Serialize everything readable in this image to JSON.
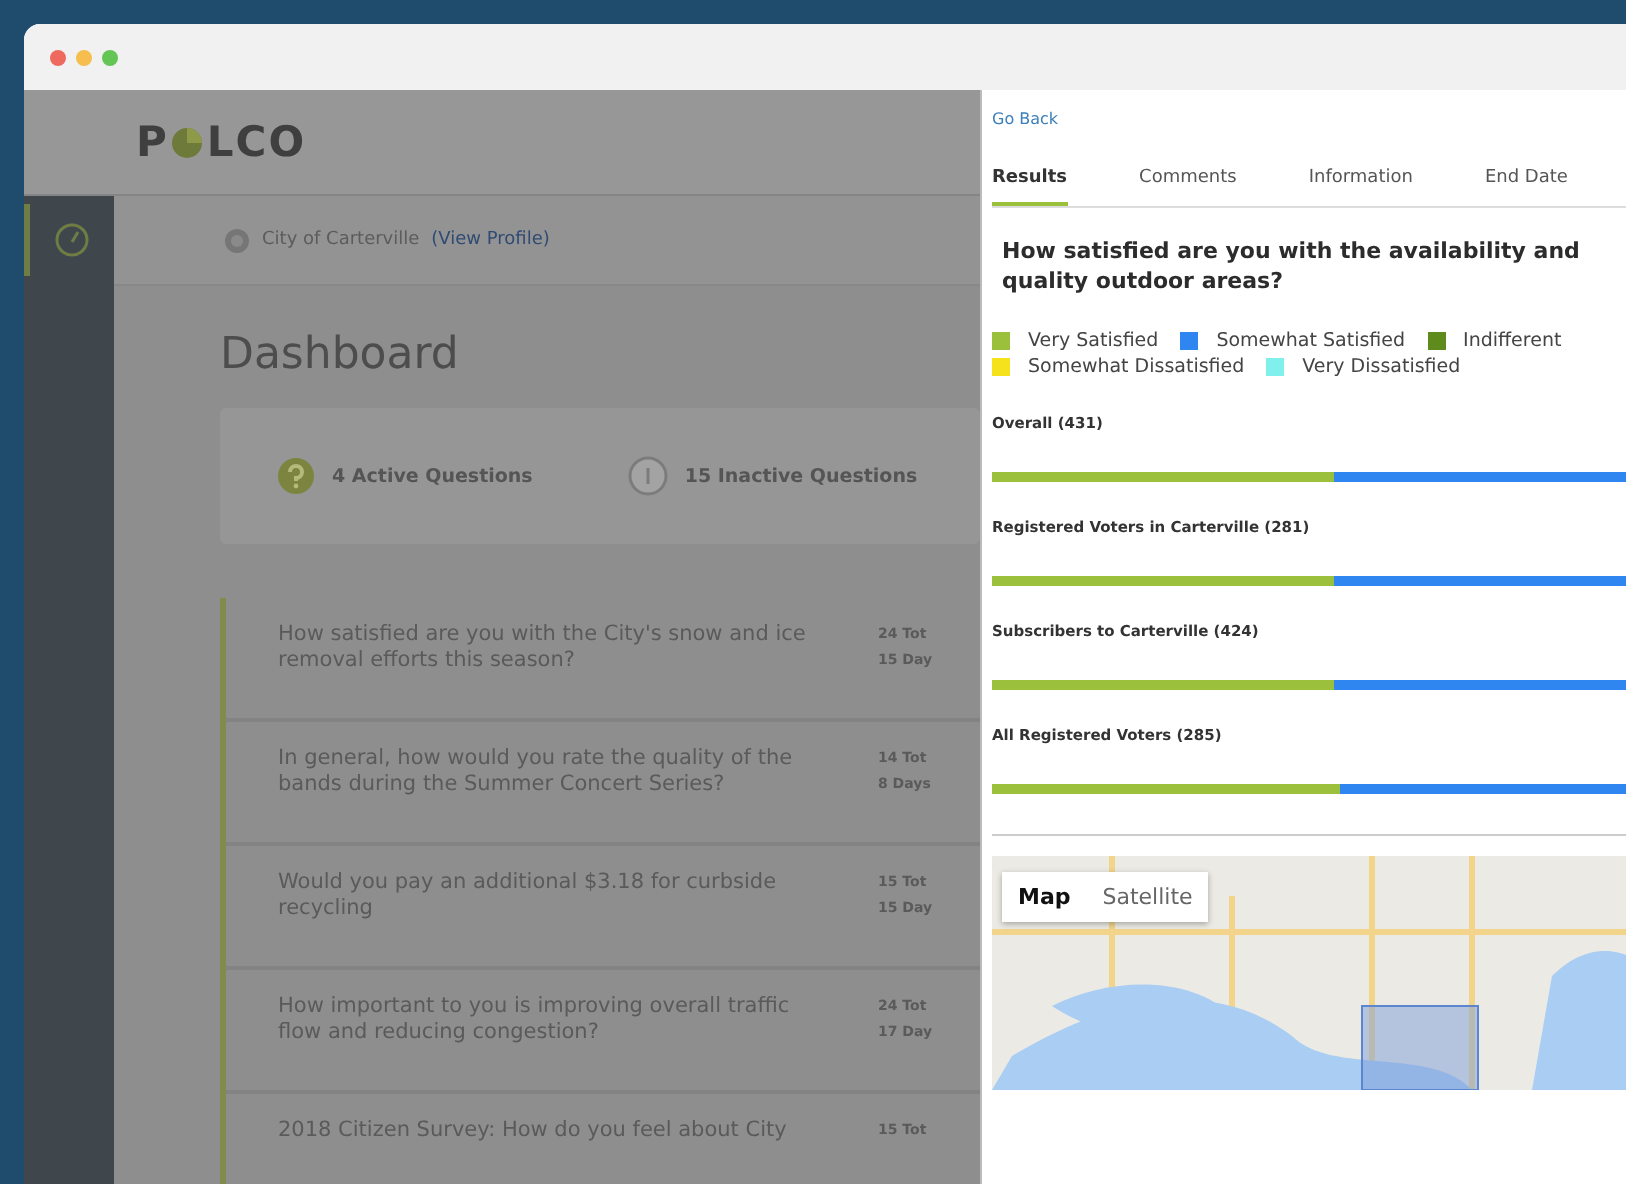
{
  "browser": {
    "dots": [
      {
        "color": "#ee6a5f"
      },
      {
        "color": "#f5be4f"
      },
      {
        "color": "#62c554"
      }
    ]
  },
  "logo": {
    "before": "P",
    "after": "LCO"
  },
  "sidebar": {
    "items": [
      {
        "selected": true
      }
    ]
  },
  "org": {
    "name": "City of Carterville",
    "link": "(View Profile)"
  },
  "page_title": "Dashboard",
  "stats": [
    {
      "kind": "active",
      "label": "4 Active Questions"
    },
    {
      "kind": "inactive",
      "label": "15 Inactive Questions"
    }
  ],
  "questions": [
    {
      "text": "How satisfied are you with the City's snow and ice removal efforts this season?",
      "total": "24 Tot",
      "days": "15 Day"
    },
    {
      "text": "In general, how would you rate the quality of the bands during the Summer Concert Series?",
      "total": "14 Tot",
      "days": "8 Days"
    },
    {
      "text": "Would you pay an additional $3.18 for curbside recycling",
      "total": "15 Tot",
      "days": "15 Day"
    },
    {
      "text": "How important to you is improving overall traffic flow and reducing congestion?",
      "total": "24 Tot",
      "days": "17 Day"
    },
    {
      "text": "2018 Citizen Survey: How do you feel about City",
      "total": "15 Tot"
    }
  ],
  "panel": {
    "back": "Go Back",
    "tabs": [
      {
        "label": "Results",
        "selected": true
      },
      {
        "label": "Comments",
        "selected": false
      },
      {
        "label": "Information",
        "selected": false
      },
      {
        "label": "End Date",
        "selected": false
      }
    ],
    "question": "How satisfied are you with the availability and quality outdoor areas?",
    "legend": [
      {
        "label": "Very Satisfied",
        "color": "#9bc03c"
      },
      {
        "label": "Somewhat Satisfied",
        "color": "#2f86f0"
      },
      {
        "label": "Indifferent",
        "color": "#5f8a1c"
      },
      {
        "label": "Somewhat Dissatisfied",
        "color": "#f5e21c"
      },
      {
        "label": "Very Dissatisfied",
        "color": "#7ff0ec"
      }
    ],
    "groups": [
      {
        "label": "Overall (431)",
        "level": 0.54
      },
      {
        "label": "Registered Voters in Carterville (281)",
        "level": 0.54
      },
      {
        "label": "Subscribers to  Carterville (424)",
        "level": 0.54
      },
      {
        "label": "All Registered Voters (285)",
        "level": 0.55
      }
    ],
    "map_types": [
      {
        "label": "Map",
        "selected": true
      },
      {
        "label": "Satellite",
        "selected": false
      }
    ]
  }
}
